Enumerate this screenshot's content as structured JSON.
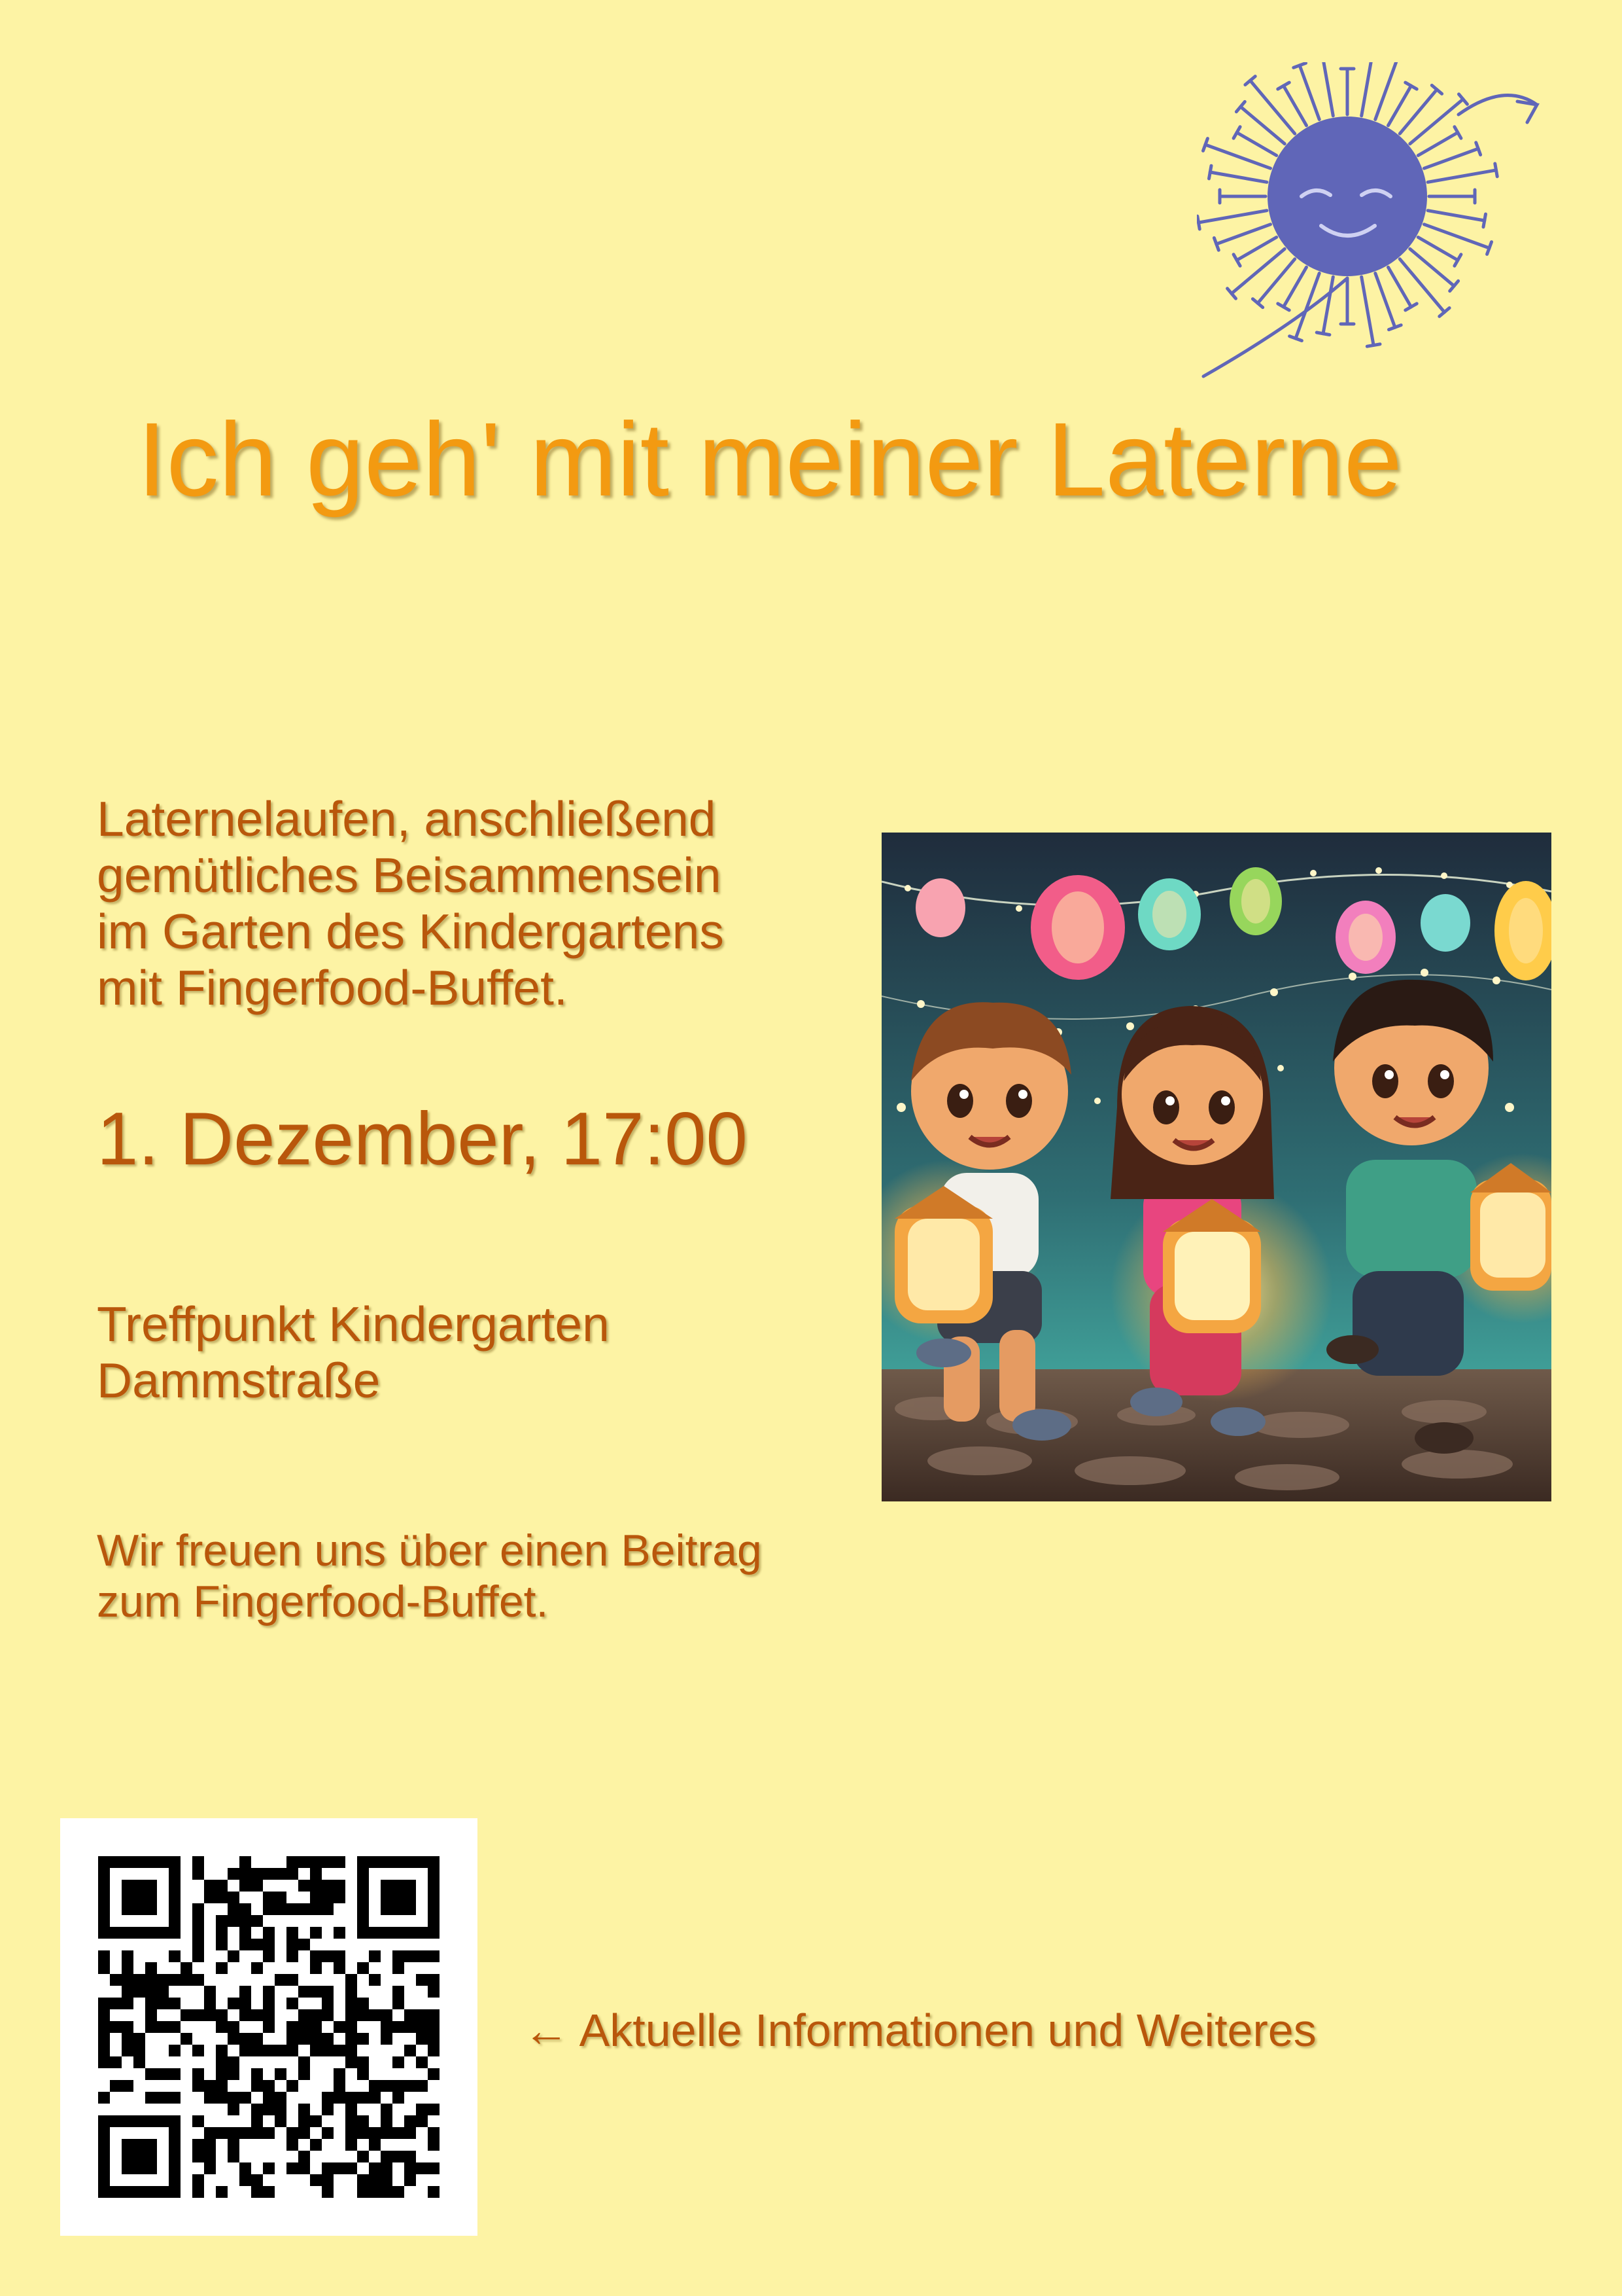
{
  "title": "Ich geh' mit meiner Laterne",
  "description_lines": [
    "Laternelaufen, anschließend",
    "gemütliches Beisammensein",
    "im Garten des Kindergartens",
    "mit Fingerfood-Buffet."
  ],
  "date": "1. Dezember, 17:00",
  "meeting_lines": [
    "Treffpunkt Kindergarten",
    "Dammstraße"
  ],
  "contribution_lines": [
    "Wir freuen uns über einen Beitrag",
    "zum Fingerfood-Buffet."
  ],
  "qr_caption": "← Aktuelle Informationen und Weiteres",
  "icons": {
    "logo": "smiling-sun-icon",
    "illustration": "children-with-lanterns-illustration",
    "qr": "qr-code"
  },
  "colors": {
    "background": "#fdf3a4",
    "title": "#f39a11",
    "body_text": "#b9570b",
    "sun": "#6066b8"
  }
}
